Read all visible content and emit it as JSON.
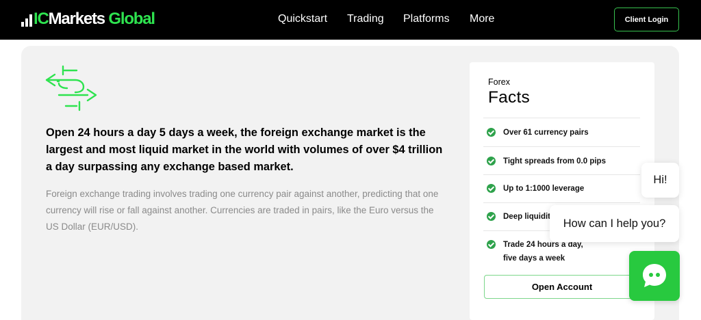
{
  "header": {
    "logo": {
      "prefix": "IC",
      "main": "Markets",
      "accent": "Global"
    },
    "nav": [
      "Quickstart",
      "Trading",
      "Platforms",
      "More"
    ],
    "client_login": "Client Login"
  },
  "main": {
    "icon": "currency-exchange-icon",
    "headline": "Open 24 hours a day 5 days a week, the foreign exchange market is the largest and most liquid market in the world with volumes of over $4 trillion a day surpassing any exchange based market.",
    "body": "Foreign exchange trading involves trading one currency pair against another, predicting that one currency will rise or fall against another. Currencies are traded in pairs, like the Euro versus the US Dollar (EUR/USD)."
  },
  "facts": {
    "eyebrow": "Forex",
    "title": "Facts",
    "items": [
      "Over 61 currency pairs",
      "Tight spreads from 0.0 pips",
      "Up to 1:1000 leverage",
      "Deep liquidity",
      [
        "Trade 24 hours a day,",
        "five days a week"
      ]
    ],
    "cta": "Open Account"
  },
  "chat": {
    "greeting": "Hi!",
    "prompt": "How can I help you?",
    "icon": "chat-bubble-icon"
  },
  "colors": {
    "brand_green": "#2ee34f",
    "check_green": "#2ea24b",
    "chat_green": "#28c93f",
    "header_bg": "#000000",
    "card_bg": "#f2f2f2"
  }
}
